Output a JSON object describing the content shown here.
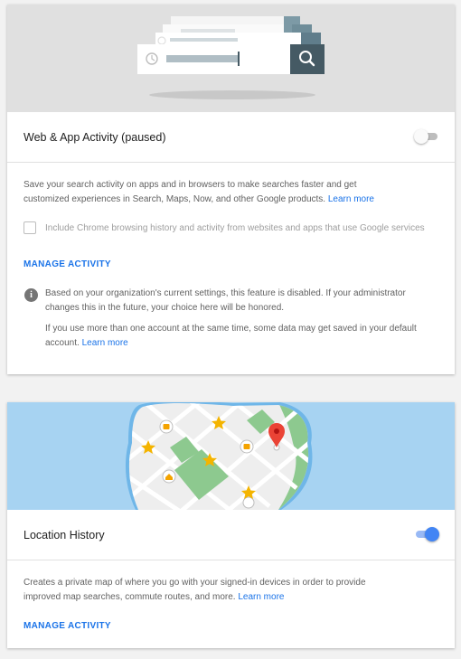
{
  "web_app_activity": {
    "title": "Web & App Activity (paused)",
    "toggle_on": false,
    "description": "Save your search activity on apps and in browsers to make searches faster and get customized experiences in Search, Maps, Now, and other Google products.",
    "learn_more": "Learn more",
    "checkbox_label": "Include Chrome browsing history and activity from websites and apps that use Google services",
    "checkbox_checked": false,
    "manage_activity": "MANAGE ACTIVITY",
    "info_text_1": "Based on your organization's current settings, this feature is disabled. If your administrator changes this in the future, your choice here will be honored.",
    "info_text_2": "If you use more than one account at the same time, some data may get saved in your default account.",
    "info_learn_more": "Learn more"
  },
  "location_history": {
    "title": "Location History",
    "toggle_on": true,
    "description": "Creates a private map of where you go with your signed-in devices in order to provide improved map searches, commute routes, and more.",
    "learn_more": "Learn more",
    "manage_activity": "MANAGE ACTIVITY"
  },
  "colors": {
    "accent": "#1a73e8",
    "toggle_on": "#4285f4",
    "map_water": "#a7d3f2",
    "map_park": "#8dc98f",
    "star": "#f4b400",
    "pin": "#ea4335"
  },
  "icons": {
    "search": "search-icon",
    "clock": "clock-icon",
    "info": "info-icon",
    "pin": "location-pin-icon",
    "star": "star-icon",
    "home": "home-icon"
  }
}
